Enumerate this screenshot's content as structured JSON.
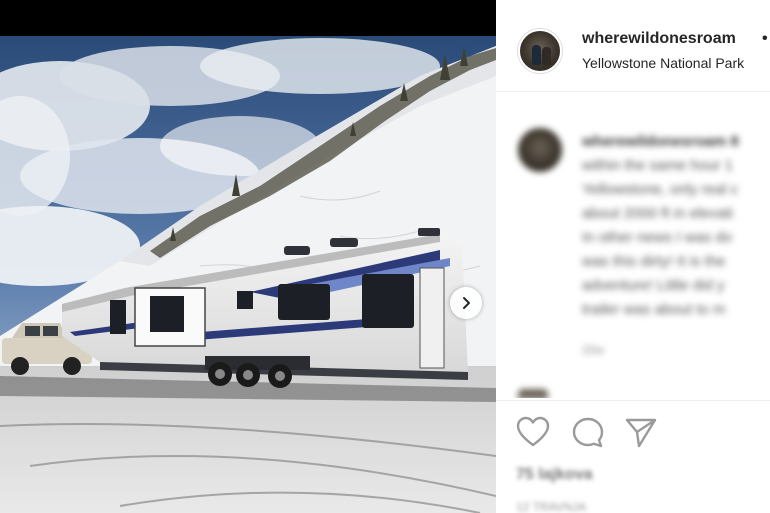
{
  "post": {
    "username": "wherewildonesroam",
    "separator": "•",
    "location": "Yellowstone National Park",
    "caption": {
      "lines": [
        "wherewildonesroam 8",
        "within the same hour 1",
        "Yellowstone, only real c",
        "about 2000 ft in elevati",
        "In other news I was do",
        "was this dirty! It is the",
        "adventure! Little did y",
        "trailer was about to m"
      ],
      "time": "20w"
    },
    "likes": "75 lajkova",
    "date": "12 TRAVNJA"
  },
  "icons": {
    "next": "chevron-right-icon",
    "like": "heart-icon",
    "comment": "comment-icon",
    "share": "share-icon"
  },
  "colors": {
    "text": "#262626",
    "muted": "#8e8e8e",
    "divider": "#efefef"
  }
}
